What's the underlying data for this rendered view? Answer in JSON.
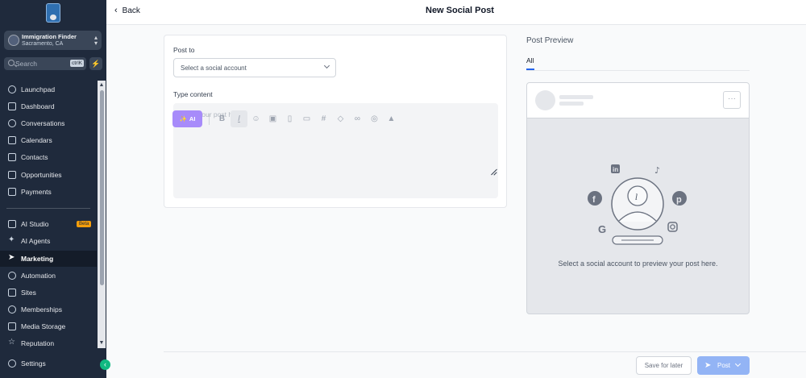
{
  "sidebar": {
    "account": {
      "name": "Immigration Finder",
      "location": "Sacramento, CA"
    },
    "search": {
      "placeholder": "Search",
      "shortcut": "ctrlK"
    },
    "items": [
      {
        "label": "Launchpad",
        "icon": "rocket-icon"
      },
      {
        "label": "Dashboard",
        "icon": "grid-icon"
      },
      {
        "label": "Conversations",
        "icon": "chat-icon"
      },
      {
        "label": "Calendars",
        "icon": "calendar-icon"
      },
      {
        "label": "Contacts",
        "icon": "contacts-icon"
      },
      {
        "label": "Opportunities",
        "icon": "network-icon"
      },
      {
        "label": "Payments",
        "icon": "payments-icon"
      }
    ],
    "items2": [
      {
        "label": "AI Studio",
        "icon": "ai-studio-icon",
        "badge": "Beta"
      },
      {
        "label": "AI Agents",
        "icon": "sparkle-icon"
      },
      {
        "label": "Marketing",
        "icon": "send-icon",
        "active": true
      },
      {
        "label": "Automation",
        "icon": "automation-icon"
      },
      {
        "label": "Sites",
        "icon": "sites-icon"
      },
      {
        "label": "Memberships",
        "icon": "membership-icon"
      },
      {
        "label": "Media Storage",
        "icon": "media-icon"
      },
      {
        "label": "Reputation",
        "icon": "star-icon"
      }
    ],
    "settings": {
      "label": "Settings"
    }
  },
  "header": {
    "back_label": "Back",
    "title": "New Social Post"
  },
  "composer": {
    "post_to_label": "Post to",
    "select_placeholder": "Select a social account",
    "type_content_label": "Type content",
    "content_placeholder": "Write your post here...",
    "ai_label": "AI",
    "toolbar": [
      "bold-icon",
      "italic-icon",
      "emoji-icon",
      "image-icon",
      "file-icon",
      "video-icon",
      "hashtag-icon",
      "tag-icon",
      "link-icon",
      "user-icon",
      "text-image-icon"
    ]
  },
  "preview": {
    "title": "Post Preview",
    "tab_all": "All",
    "message": "Select a social account to preview your post here."
  },
  "footer": {
    "save_later": "Save for later",
    "post": "Post"
  },
  "colors": {
    "sidebar": "#1f2a3c",
    "accent": "#2563eb",
    "ai": "#a78bfa",
    "post_btn": "#93b4f5"
  }
}
